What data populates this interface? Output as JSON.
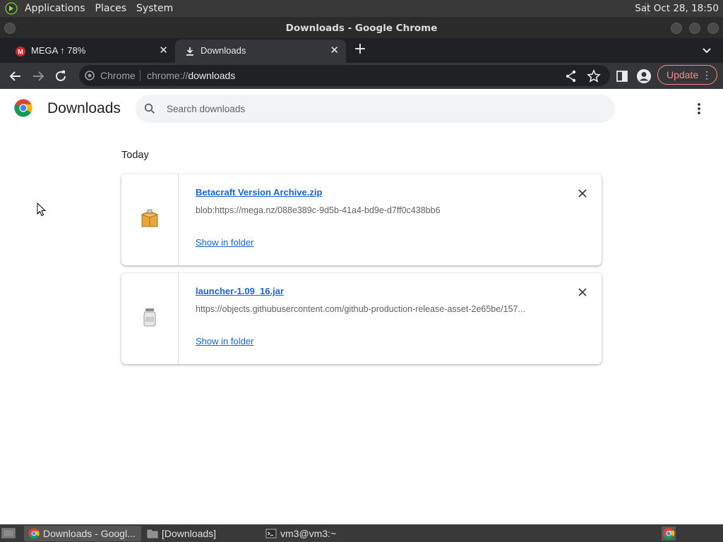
{
  "top_panel": {
    "menus": [
      "Applications",
      "Places",
      "System"
    ],
    "clock": "Sat Oct 28, 18:50"
  },
  "window": {
    "title": "Downloads - Google Chrome"
  },
  "tabs": [
    {
      "label": "MEGA ↑ 78%",
      "active": false
    },
    {
      "label": "Downloads",
      "active": true
    }
  ],
  "toolbar": {
    "chip_label": "Chrome",
    "url_scheme": "chrome://",
    "url_host": "downloads",
    "update_label": "Update"
  },
  "page": {
    "title": "Downloads",
    "search_placeholder": "Search downloads",
    "section_label": "Today",
    "downloads": [
      {
        "filename": "Betacraft Version Archive.zip",
        "url": "blob:https://mega.nz/088e389c-9d5b-41a4-bd9e-d7ff0c438bb6",
        "action": "Show in folder",
        "icon": "zip-archive-icon"
      },
      {
        "filename": "launcher-1.09_16.jar",
        "url": "https://objects.githubusercontent.com/github-production-release-asset-2e65be/157...",
        "action": "Show in folder",
        "icon": "jar-file-icon"
      }
    ]
  },
  "taskbar": {
    "items": [
      {
        "label": "Downloads - Googl...",
        "active": true
      },
      {
        "label": "[Downloads]",
        "active": false
      },
      {
        "label": "vm3@vm3:~",
        "active": false
      }
    ]
  },
  "colors": {
    "accent_link": "#1967d2",
    "update_border": "#f28b82",
    "chrome_dark": "#202124",
    "toolbar": "#35363a"
  }
}
